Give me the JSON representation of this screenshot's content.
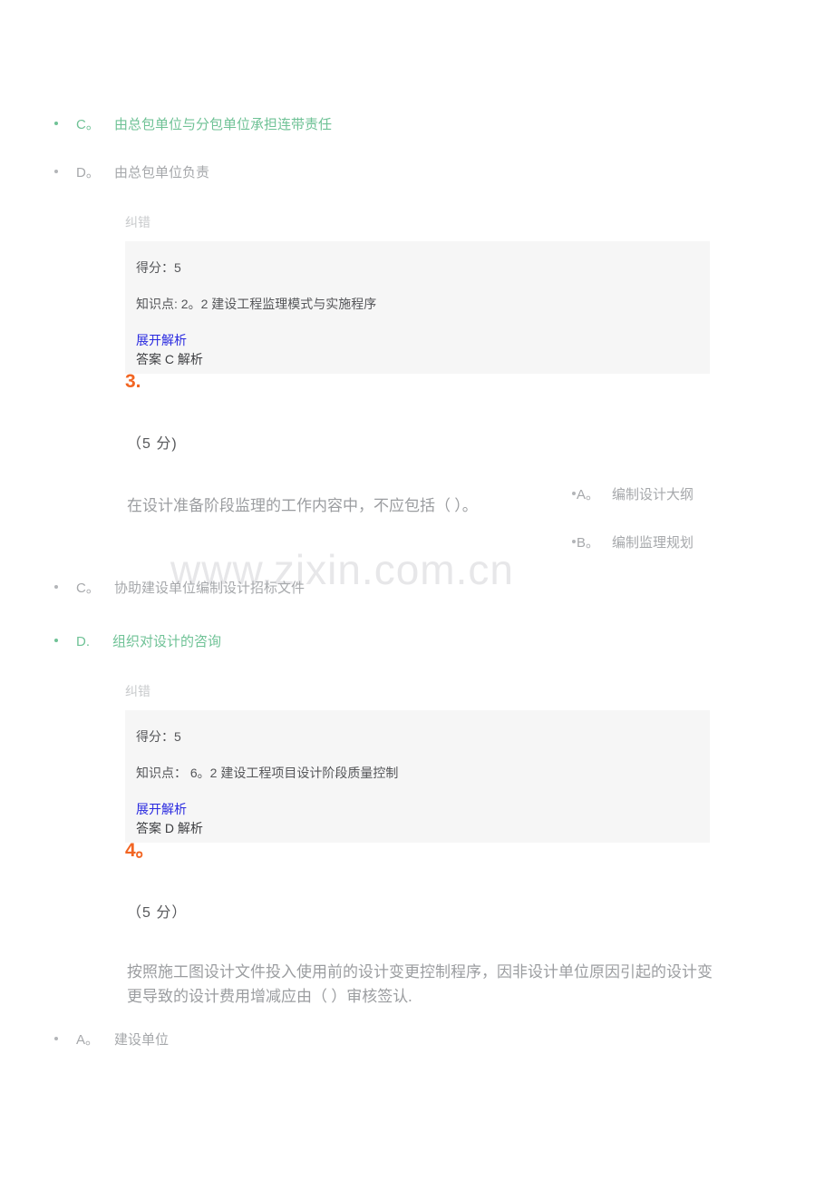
{
  "watermark": {
    "text": "www.zixin.com.cn"
  },
  "labels": {
    "correction": "纠错",
    "expand_analysis": "展开解析"
  },
  "questions": [
    {
      "number": null,
      "visible_options": [
        {
          "letter": "C。",
          "text": "由总包单位与分包单位承担连带责任",
          "selected": true
        },
        {
          "letter": "D。",
          "text": "由总包单位负责",
          "selected": false
        }
      ],
      "info": {
        "score_label": "得分：",
        "score_value": "5",
        "knowledge_label": "知识点:",
        "knowledge_value": "2。2 建设工程监理模式与实施程序",
        "answer_line": "答案 C 解析"
      }
    },
    {
      "number": "3.",
      "score_text": "（5 分)",
      "stem": "在设计准备阶段监理的工作内容中，不应包括（ ）。",
      "options_right": [
        {
          "letter": "A。",
          "text": "编制设计大纲"
        },
        {
          "letter": "B。",
          "text": "编制监理规划"
        }
      ],
      "options_left": [
        {
          "letter": "C。",
          "text": "协助建设单位编制设计招标文件",
          "selected": false
        },
        {
          "letter": "D.",
          "text": "组织对设计的咨询",
          "selected": true
        }
      ],
      "info": {
        "score_label": "得分：",
        "score_value": "5",
        "knowledge_label": "知识点：",
        "knowledge_value": "6。2 建设工程项目设计阶段质量控制",
        "answer_line": "答案 D 解析"
      }
    },
    {
      "number": "4。",
      "score_text": "（5 分）",
      "stem": "按照施工图设计文件投入使用前的设计变更控制程序，因非设计单位原因引起的设计变更导致的设计费用增减应由（ ）审核签认.",
      "options_left": [
        {
          "letter": "A。",
          "text": "建设单位",
          "selected": false
        }
      ]
    }
  ],
  "colors": {
    "accent_orange": "#f26522",
    "selected_green": "#6fc296",
    "link_blue": "#2a2ae0",
    "muted_gray": "#a6a8ab",
    "box_bg": "#f6f6f6"
  }
}
